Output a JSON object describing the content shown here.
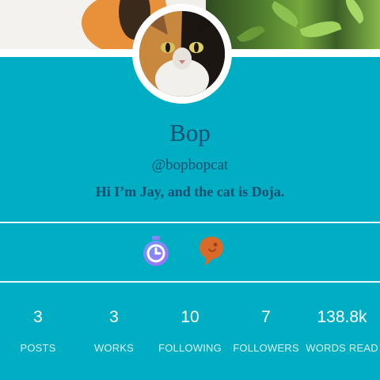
{
  "profile": {
    "name": "Bop",
    "handle": "@bopbopcat",
    "bio": "Hi I’m Jay, and the cat is Doja."
  },
  "badges": [
    {
      "icon": "stopwatch-icon",
      "color": "#8f7dfb"
    },
    {
      "icon": "speech-bubble-icon",
      "color": "#d96a2a"
    }
  ],
  "stats": [
    {
      "value": "3",
      "label": "POSTS"
    },
    {
      "value": "3",
      "label": "WORKS"
    },
    {
      "value": "10",
      "label": "FOLLOWING"
    },
    {
      "value": "7",
      "label": "FOLLOWERS"
    },
    {
      "value": "138.8k",
      "label": "WORDS READ"
    }
  ],
  "colors": {
    "background": "#00aec3",
    "text_dark": "#174f72",
    "divider": "#e8f7f9"
  }
}
